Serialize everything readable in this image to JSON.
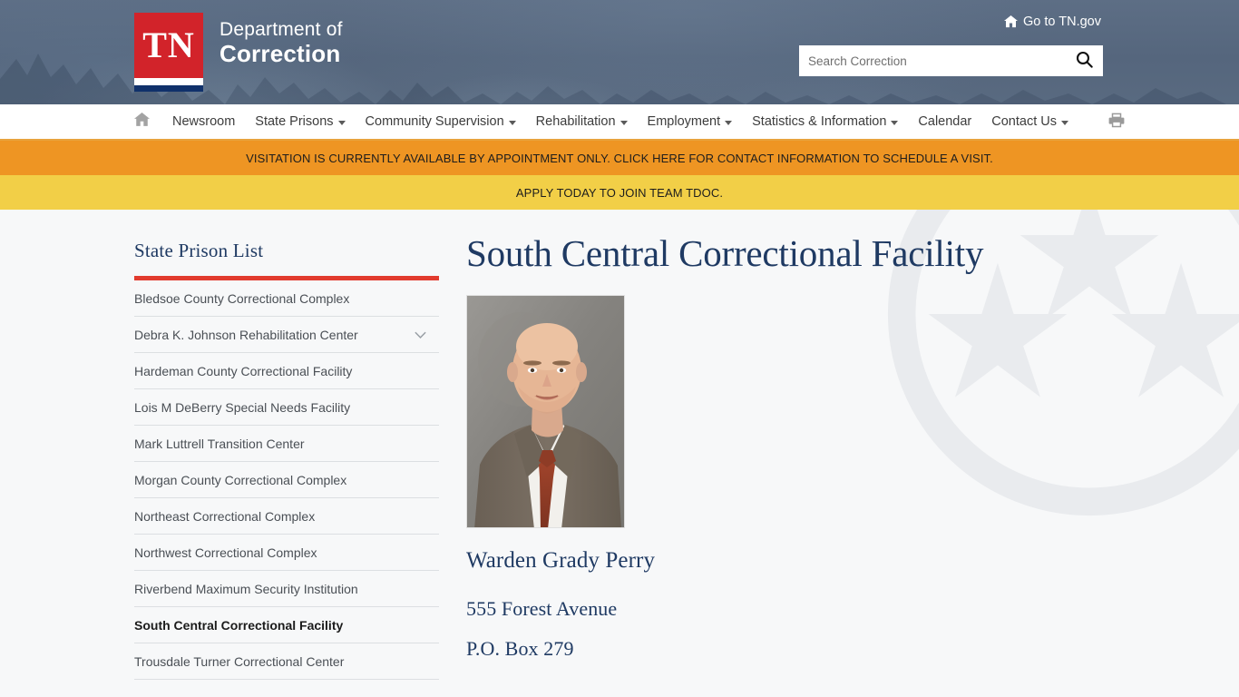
{
  "header": {
    "logo": {
      "mark_text": "TN",
      "line1": "Department of",
      "line2": "Correction"
    },
    "tngov_label": "Go to TN.gov",
    "search": {
      "placeholder": "Search Correction",
      "value": ""
    }
  },
  "nav": {
    "home_icon": "home-icon",
    "items": [
      {
        "label": "Newsroom",
        "has_caret": false
      },
      {
        "label": "State Prisons",
        "has_caret": true
      },
      {
        "label": "Community Supervision",
        "has_caret": true
      },
      {
        "label": "Rehabilitation",
        "has_caret": true
      },
      {
        "label": "Employment",
        "has_caret": true
      },
      {
        "label": "Statistics & Information",
        "has_caret": true
      },
      {
        "label": "Calendar",
        "has_caret": false
      },
      {
        "label": "Contact Us",
        "has_caret": true
      }
    ],
    "print_icon": "printer-icon"
  },
  "alerts": [
    {
      "text": "VISITATION IS CURRENTLY AVAILABLE BY APPOINTMENT ONLY. CLICK HERE FOR CONTACT INFORMATION TO SCHEDULE A VISIT.",
      "color": "#ee9523"
    },
    {
      "text": "APPLY TODAY TO JOIN TEAM TDOC.",
      "color": "#f2cf47"
    }
  ],
  "sidebar": {
    "title": "State Prison List",
    "accent_color": "#e23b2e",
    "items": [
      {
        "label": "Bledsoe County Correctional Complex",
        "active": false,
        "expandable": false
      },
      {
        "label": "Debra K. Johnson Rehabilitation Center",
        "active": false,
        "expandable": true
      },
      {
        "label": "Hardeman County Correctional Facility",
        "active": false,
        "expandable": false
      },
      {
        "label": "Lois M DeBerry Special Needs Facility",
        "active": false,
        "expandable": false
      },
      {
        "label": "Mark Luttrell Transition Center",
        "active": false,
        "expandable": false
      },
      {
        "label": "Morgan County Correctional Complex",
        "active": false,
        "expandable": false
      },
      {
        "label": "Northeast Correctional Complex",
        "active": false,
        "expandable": false
      },
      {
        "label": "Northwest Correctional Complex",
        "active": false,
        "expandable": false
      },
      {
        "label": "Riverbend Maximum Security Institution",
        "active": false,
        "expandable": false
      },
      {
        "label": "South Central Correctional Facility",
        "active": true,
        "expandable": false
      },
      {
        "label": "Trousdale Turner Correctional Center",
        "active": false,
        "expandable": false
      }
    ]
  },
  "main": {
    "title": "South Central Correctional Facility",
    "warden_photo_alt": "warden-portrait",
    "warden_name": "Warden Grady Perry",
    "address_line1": "555 Forest Avenue",
    "address_line2": "P.O. Box 279"
  },
  "colors": {
    "header_bg": "#5a6b81",
    "brand_red": "#d2232a",
    "brand_navy": "#10316b",
    "nav_underline": "#e8a33d",
    "title_navy": "#1f3a63"
  }
}
